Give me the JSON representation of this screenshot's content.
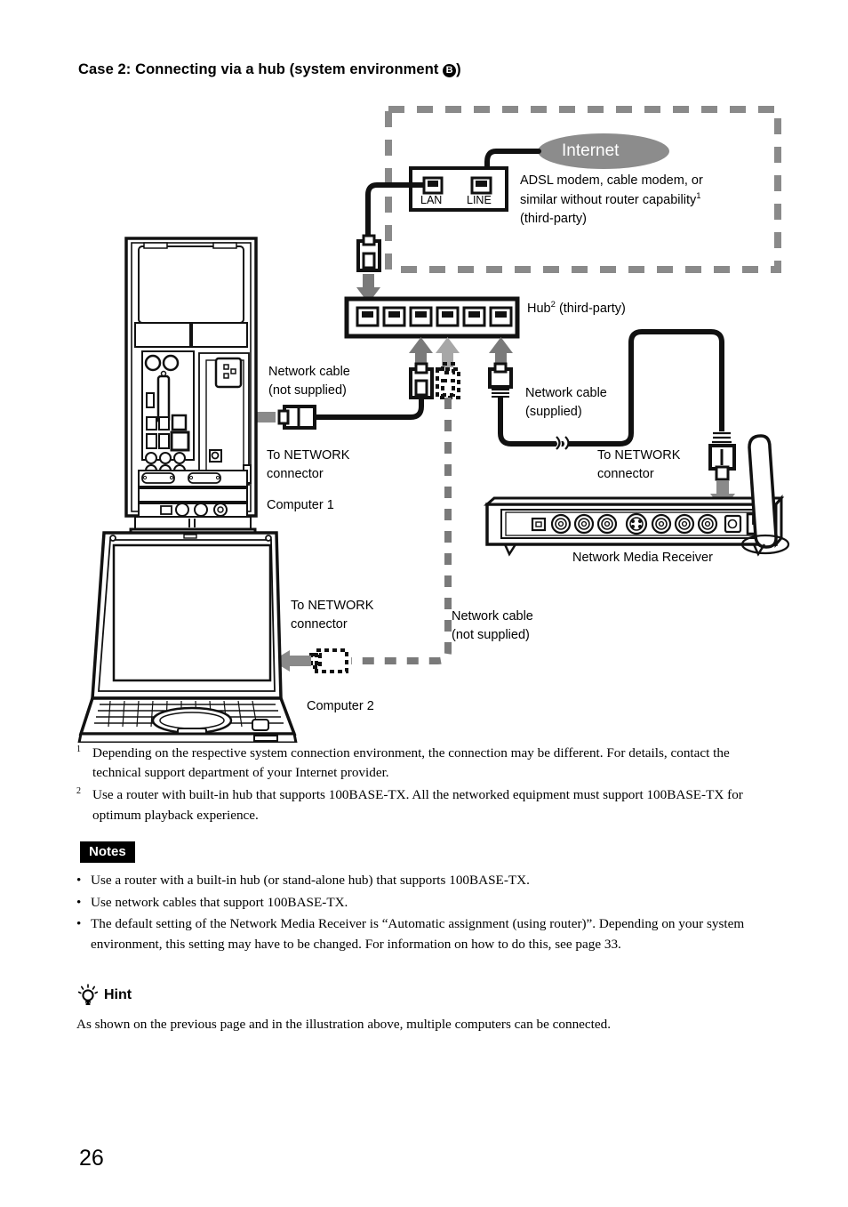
{
  "heading": {
    "prefix": "Case 2: Connecting via a hub (system environment ",
    "badge": "B",
    "suffix": ")"
  },
  "diagram": {
    "internet_label": "Internet",
    "modem_ports": {
      "lan": "LAN",
      "line": "LINE"
    },
    "modem_desc_line1": "ADSL modem, cable modem, or",
    "modem_desc_line2": "similar without router capability",
    "modem_desc_sup": "1",
    "modem_desc_line3": "(third-party)",
    "hub_label": "Hub",
    "hub_sup": "2",
    "hub_label_tail": "(third-party)",
    "cable_notsupplied_1_l1": "Network cable",
    "cable_notsupplied_1_l2": "(not supplied)",
    "to_network_1_l1": "To NETWORK",
    "to_network_1_l2": "connector",
    "computer1": "Computer 1",
    "cable_supplied_l1": "Network cable",
    "cable_supplied_l2": "(supplied)",
    "to_network_2_l1": "To NETWORK",
    "to_network_2_l2": "connector",
    "receiver_label": "Network Media Receiver",
    "to_network_3_l1": "To NETWORK",
    "to_network_3_l2": "connector",
    "cable_notsupplied_2_l1": "Network cable",
    "cable_notsupplied_2_l2": "(not supplied)",
    "computer2": "Computer 2"
  },
  "footnotes": [
    {
      "mark": "1",
      "text": "Depending on the respective system connection environment, the connection may be different. For details, contact the technical support department of your Internet provider."
    },
    {
      "mark": "2",
      "text": "Use a router with built-in hub that supports 100BASE-TX. All the networked equipment must support 100BASE-TX for optimum playback experience."
    }
  ],
  "notes": {
    "badge": "Notes",
    "bullet": "•",
    "items": [
      "Use a router with a built-in hub (or stand-alone hub) that supports 100BASE-TX.",
      "Use network cables that support 100BASE-TX.",
      "The default setting of the Network Media Receiver is “Automatic assignment (using router)”. Depending on your system environment, this setting may have to be changed. For information on how to do this, see page 33."
    ]
  },
  "hint": {
    "title": "Hint",
    "body": "As shown on the previous page and in the illustration above, multiple computers can be connected."
  },
  "page_number": "26",
  "colors": {
    "gray": "#808080",
    "dark_gray": "#6e6e6e",
    "line": "#1a1a1a",
    "internet_fill": "#8c8c8c"
  }
}
